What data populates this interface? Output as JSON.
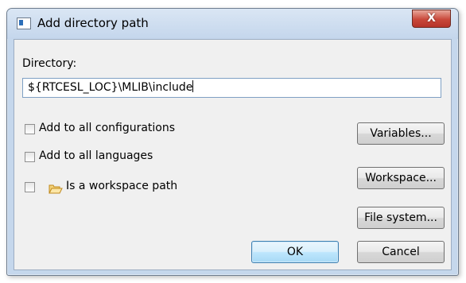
{
  "window": {
    "title": "Add directory path",
    "close_glyph": "X"
  },
  "directory": {
    "label": "Directory:",
    "value": "${RTCESL_LOC}\\MLIB\\include"
  },
  "options": {
    "add_all_configs": "Add to all configurations",
    "add_all_languages": "Add to all languages",
    "workspace_path": "Is a workspace path",
    "workspace_path_icon": "folder-icon"
  },
  "buttons": {
    "variables": "Variables...",
    "workspace": "Workspace...",
    "file_system": "File system...",
    "ok": "OK",
    "cancel": "Cancel"
  },
  "colors": {
    "title_bar": "#c4d6ec",
    "close_button": "#c9483a",
    "default_button": "#bee6fd"
  }
}
